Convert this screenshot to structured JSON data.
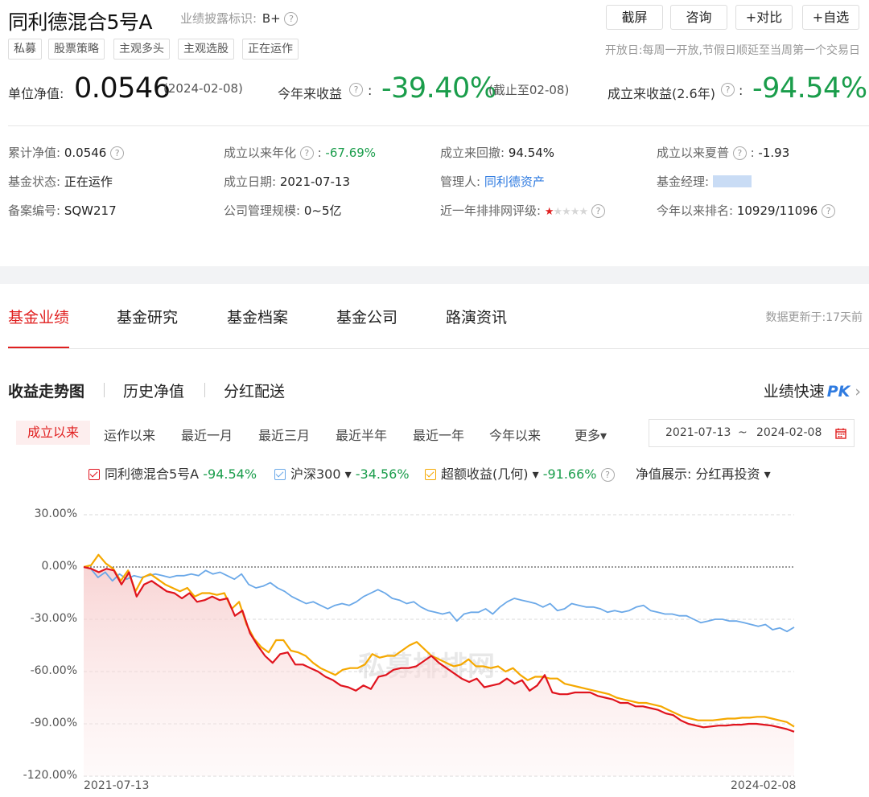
{
  "header": {
    "fund_name": "同利德混合5号A",
    "disclosure_label": "业绩披露标识:",
    "disclosure_value": "B+",
    "help": "?",
    "buttons": {
      "screenshot": "截屏",
      "consult": "咨询",
      "compare": "+对比",
      "watchlist": "+自选"
    },
    "tags": [
      "私募",
      "股票策略",
      "主观多头",
      "主观选股",
      "正在运作"
    ],
    "open_day": "开放日:每周一开放,节假日顺延至当周第一个交易日"
  },
  "summary": {
    "nav_label": "单位净值:",
    "nav_value": "0.0546",
    "nav_date": "(2024-02-08)",
    "ytd_label": "今年来收益",
    "colon": ":",
    "ytd_value": "-39.40%",
    "ytd_note": "(截止至02-08)",
    "since_label": "成立来收益(2.6年)",
    "since_value": "-94.54%"
  },
  "info": {
    "cum_nav_label": "累计净值:",
    "cum_nav": "0.0546",
    "annual_label": "成立以来年化",
    "annual": "-67.69%",
    "drawdown_label": "成立来回撤:",
    "drawdown": "94.54%",
    "sharpe_label": "成立以来夏普",
    "sharpe": "-1.93",
    "status_label": "基金状态:",
    "status": "正在运作",
    "inception_label": "成立日期:",
    "inception": "2021-07-13",
    "manager_co_label": "管理人:",
    "manager_co": "同利德资产",
    "manager_label": "基金经理:",
    "reg_label": "备案编号:",
    "reg": "SQW217",
    "scale_label": "公司管理规模:",
    "scale": "0~5亿",
    "rating_label": "近一年排排网评级:",
    "rating_stars": 1,
    "rank_label": "今年以来排名:",
    "rank": "10929/11096"
  },
  "main_tabs": [
    "基金业绩",
    "基金研究",
    "基金档案",
    "基金公司",
    "路演资讯"
  ],
  "data_update": "数据更新于:17天前",
  "sub_tabs": [
    "收益走势图",
    "历史净值",
    "分红配送"
  ],
  "perf_pk": {
    "label": "业绩快速",
    "pk": "PK",
    "arrow": "›"
  },
  "period_tabs": [
    "成立以来",
    "运作以来",
    "最近一月",
    "最近三月",
    "最近半年",
    "最近一年",
    "今年以来",
    "更多▾"
  ],
  "date_range": {
    "start": "2021-07-13",
    "sep": "~",
    "end": "2024-02-08"
  },
  "legend": {
    "fund_name": "同利德混合5号A",
    "fund_value": "-94.54%",
    "index_name": "沪深300 ▾",
    "index_value": "-34.56%",
    "excess_name": "超额收益(几何) ▾",
    "excess_value": "-91.66%",
    "nav_display_label": "净值展示:",
    "nav_display_value": "分红再投资 ▾"
  },
  "colors": {
    "fund": "#e0141e",
    "index": "#6aa8e8",
    "excess": "#f5a800",
    "accent": "#e02020",
    "positive": "#1a9d4b"
  },
  "chart_data": {
    "type": "line",
    "x_start": "2021-07-13",
    "x_end": "2024-02-08",
    "x_tick_labels": [
      "2021-07-13",
      "2024-02-08"
    ],
    "y_ticks": [
      "30.00%",
      "0.00%",
      "-30.00%",
      "-60.00%",
      "-90.00%",
      "-120.00%"
    ],
    "ylim": [
      -120,
      30
    ],
    "watermark": "私募排排网",
    "series": [
      {
        "name": "同利德混合5号A",
        "color": "#e0141e",
        "fill": true,
        "values": [
          0,
          -1,
          -3,
          -1,
          -2,
          -10,
          -3,
          -17,
          -10,
          -8,
          -11,
          -14,
          -15,
          -18,
          -15,
          -20,
          -19,
          -17,
          -19,
          -18,
          -28,
          -25,
          -38,
          -45,
          -51,
          -55,
          -50,
          -49,
          -56,
          -56,
          -58,
          -60,
          -63,
          -65,
          -68,
          -69,
          -71,
          -68,
          -70,
          -63,
          -62,
          -59,
          -58,
          -58,
          -57,
          -54,
          -51,
          -55,
          -58,
          -61,
          -64,
          -66,
          -64,
          -69,
          -68,
          -67,
          -64,
          -67,
          -65,
          -71,
          -68,
          -62,
          -72,
          -73,
          -73,
          -72,
          -72,
          -72,
          -74,
          -75,
          -76,
          -78,
          -78,
          -80,
          -80,
          -81,
          -82,
          -84,
          -85,
          -88,
          -90,
          -91,
          -92,
          -91.5,
          -91,
          -91,
          -90.5,
          -90.5,
          -90,
          -90,
          -90.5,
          -91,
          -92,
          -93,
          -94.54
        ]
      },
      {
        "name": "沪深300",
        "color": "#6aa8e8",
        "fill": false,
        "values": [
          0,
          -1,
          -6,
          -3,
          -8,
          -4,
          -7,
          -5,
          -6,
          -5,
          -4,
          -5,
          -6,
          -5,
          -5,
          -4,
          -5,
          -2,
          -4,
          -3,
          -5,
          -7,
          -4,
          -10,
          -12,
          -11,
          -9,
          -12,
          -14,
          -17,
          -19,
          -21,
          -20,
          -22,
          -24,
          -22,
          -21,
          -22,
          -20,
          -17,
          -15,
          -13,
          -15,
          -18,
          -19,
          -21,
          -20,
          -23,
          -25,
          -26,
          -27,
          -26,
          -31,
          -27,
          -26,
          -26,
          -24,
          -27,
          -23,
          -20,
          -18,
          -19,
          -20,
          -21,
          -23,
          -21,
          -25,
          -24,
          -21,
          -22,
          -23,
          -23,
          -24,
          -26,
          -25,
          -26,
          -25,
          -23,
          -22,
          -25,
          -26,
          -27,
          -27,
          -28,
          -28,
          -30,
          -32,
          -31,
          -30,
          -30,
          -31,
          -31,
          -32,
          -33,
          -34,
          -33,
          -36,
          -35,
          -37,
          -34.56
        ]
      },
      {
        "name": "超额收益(几何)",
        "color": "#f5a800",
        "fill": false,
        "values": [
          0,
          1,
          7,
          2,
          -1,
          -8,
          -2,
          -14,
          -6,
          -4,
          -7,
          -10,
          -12,
          -14,
          -12,
          -17,
          -15,
          -15,
          -16,
          -15,
          -24,
          -20,
          -33,
          -41,
          -46,
          -49,
          -42,
          -42,
          -48,
          -49,
          -51,
          -55,
          -58,
          -60,
          -62,
          -59,
          -58,
          -58,
          -56,
          -50,
          -52,
          -51,
          -51,
          -48,
          -45,
          -43,
          -47,
          -51,
          -53,
          -55,
          -57,
          -56,
          -53,
          -57,
          -57,
          -58,
          -57,
          -60,
          -58,
          -62,
          -65,
          -63,
          -63,
          -64,
          -64,
          -67,
          -68,
          -69,
          -70,
          -71,
          -72,
          -73,
          -75,
          -76,
          -77,
          -78,
          -78,
          -79,
          -80,
          -82,
          -84,
          -86,
          -87,
          -88,
          -88,
          -88,
          -87.5,
          -87,
          -87,
          -86.5,
          -86.5,
          -86,
          -86,
          -87,
          -88,
          -89,
          -91.66
        ]
      }
    ]
  }
}
